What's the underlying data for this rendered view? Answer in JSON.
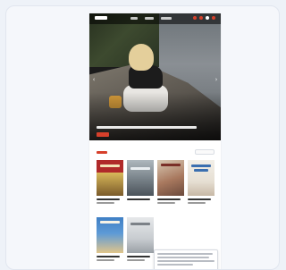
{
  "colors": {
    "accent": "#d6402b",
    "accept_button": "#2fa84f",
    "secondary_button": "#9ea3aa",
    "page_background": "#eef2f8"
  },
  "icons": {
    "prev": "chevron-left-icon",
    "next": "chevron-right-icon"
  },
  "carousel": {
    "prev_glyph": "‹",
    "next_glyph": "›"
  }
}
